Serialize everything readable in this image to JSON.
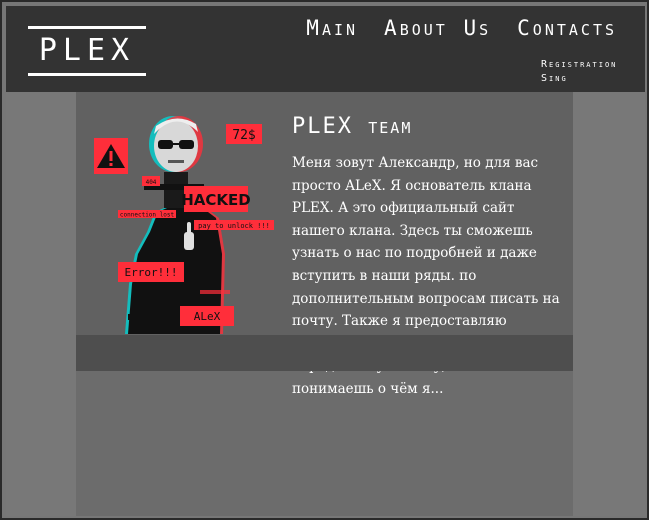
{
  "logo": {
    "text": "PLEX"
  },
  "nav": {
    "items": [
      "Main",
      "About Us",
      "Contacts"
    ]
  },
  "auth": {
    "registration": "Registration",
    "sign": "Sing"
  },
  "team": {
    "title": "PLEX team",
    "description": "Меня зовут Александр, но для вас просто ALeX. Я основатель клана PLEX. А это официальный сайт нашего клана. Здесь ты сможешь узнать о нас по подробней и даже вступить в наши ряды. по дополнительным вопросам писать на почту. Также я предоставляю определённые услуги за определённую плату, если ты понимаешь о чём я..."
  },
  "image_labels": {
    "price": "72$",
    "hacked": "HACKED",
    "error": "Error!!!",
    "name": "ALeX",
    "unlock": "pay to unlock !!!",
    "small1": "404",
    "small2": "connection lost"
  },
  "colors": {
    "accent": "#ff2e3a",
    "header_bg": "#333333",
    "card_bg": "#616161"
  }
}
